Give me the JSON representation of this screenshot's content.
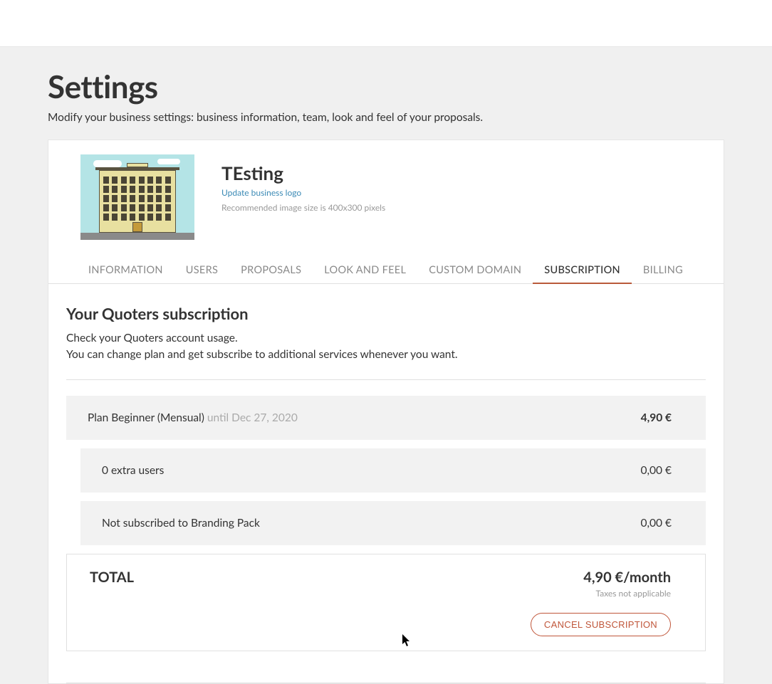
{
  "page": {
    "title": "Settings",
    "subtitle": "Modify your business settings: business information, team, look and feel of your proposals."
  },
  "business": {
    "name": "TEsting",
    "update_logo_link": "Update business logo",
    "image_note": "Recommended image size is 400x300 pixels"
  },
  "tabs": [
    {
      "label": "INFORMATION"
    },
    {
      "label": "USERS"
    },
    {
      "label": "PROPOSALS"
    },
    {
      "label": "LOOK AND FEEL"
    },
    {
      "label": "CUSTOM DOMAIN"
    },
    {
      "label": "SUBSCRIPTION"
    },
    {
      "label": "BILLING"
    }
  ],
  "subscription": {
    "heading": "Your Quoters subscription",
    "line1": "Check your Quoters account usage.",
    "line2": "You can change plan and get subscribe to additional services whenever you want.",
    "plan": {
      "label": "Plan Beginner (Mensual) ",
      "until": "until Dec 27, 2020",
      "price": "4,90 €"
    },
    "extra_users": {
      "label": "0 extra users",
      "price": "0,00 €"
    },
    "branding": {
      "label": "Not subscribed to Branding Pack",
      "price": "0,00 €"
    },
    "total": {
      "label": "TOTAL",
      "amount": "4,90 €/month",
      "taxes": "Taxes not applicable",
      "cancel_button": "CANCEL SUBSCRIPTION"
    }
  }
}
